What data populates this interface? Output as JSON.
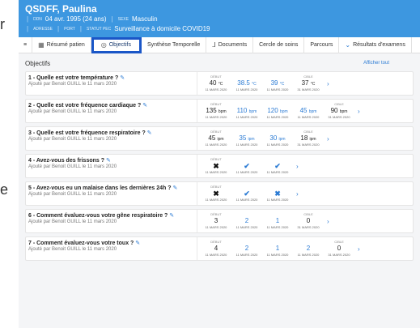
{
  "stray": [
    "r",
    "e"
  ],
  "patient": {
    "name": "QSDFF, Paulina",
    "ddn_label": "DDN",
    "ddn": "04 avr. 1995 (24 ans)",
    "sexe_label": "SEXE",
    "sexe": "Masculin",
    "adresse_label": "ADRESSE",
    "port_label": "PORT",
    "statut_label": "STATUT PEC",
    "statut": "Surveillance à domicile COVID19"
  },
  "nav": {
    "menu_icon": "hamburger-icon",
    "tabs": [
      {
        "label": "Résumé patien",
        "icon": "grid-icon"
      },
      {
        "label": "Objectifs",
        "icon": "target-icon"
      },
      {
        "label": "Synthèse Temporelle",
        "icon": ""
      },
      {
        "label": "Documents",
        "icon": "pin-icon"
      },
      {
        "label": "Cercle de soins",
        "icon": ""
      },
      {
        "label": "Parcours",
        "icon": ""
      },
      {
        "label": "Résultats d'examens",
        "icon": "chart-icon"
      }
    ]
  },
  "section": {
    "title": "Objectifs",
    "show_all": "Afficher tout"
  },
  "rows": [
    {
      "question": "1 - Quelle est votre température ?",
      "meta": "Ajouté par Benoit GUILL le 11 mars 2020",
      "cells": [
        {
          "label": "DÉBUT",
          "value": "40",
          "unit": "°C",
          "date": "11 MARS 2020",
          "kind": "text",
          "color": "dark"
        },
        {
          "label": "",
          "value": "38.5",
          "unit": "°C",
          "date": "11 MARS 2020",
          "kind": "text",
          "color": "blue"
        },
        {
          "label": "",
          "value": "39",
          "unit": "°C",
          "date": "11 MARS 2020",
          "kind": "text",
          "color": "blue"
        },
        {
          "label": "CIBLE",
          "value": "37",
          "unit": "°C",
          "date": "31 MARS 2020",
          "kind": "text",
          "color": "dark"
        }
      ]
    },
    {
      "question": "2 - Quelle est votre fréquence cardiaque ?",
      "meta": "Ajouté par Benoit GUILL le 11 mars 2020",
      "cells": [
        {
          "label": "DÉBUT",
          "value": "135",
          "unit": "bpm",
          "date": "11 MARS 2020",
          "kind": "text",
          "color": "dark"
        },
        {
          "label": "",
          "value": "110",
          "unit": "bpm",
          "date": "11 MARS 2020",
          "kind": "text",
          "color": "blue"
        },
        {
          "label": "",
          "value": "120",
          "unit": "bpm",
          "date": "11 MARS 2020",
          "kind": "text",
          "color": "blue"
        },
        {
          "label": "",
          "value": "45",
          "unit": "bpm",
          "date": "11 MARS 2020",
          "kind": "text",
          "color": "blue"
        },
        {
          "label": "CIBLE",
          "value": "90",
          "unit": "bpm",
          "date": "31 MARS 2020",
          "kind": "text",
          "color": "dark"
        }
      ]
    },
    {
      "question": "3 - Quelle est votre fréquence respiratoire ?",
      "meta": "Ajouté par Benoit GUILL le 11 mars 2020",
      "cells": [
        {
          "label": "DÉBUT",
          "value": "45",
          "unit": "ipm",
          "date": "11 MARS 2020",
          "kind": "text",
          "color": "dark"
        },
        {
          "label": "",
          "value": "35",
          "unit": "ipm",
          "date": "11 MARS 2020",
          "kind": "text",
          "color": "blue"
        },
        {
          "label": "",
          "value": "30",
          "unit": "ipm",
          "date": "11 MARS 2020",
          "kind": "text",
          "color": "blue"
        },
        {
          "label": "CIBLE",
          "value": "18",
          "unit": "ipm",
          "date": "31 MARS 2020",
          "kind": "text",
          "color": "dark"
        }
      ]
    },
    {
      "question": "4 - Avez-vous des frissons ?",
      "meta": "Ajouté par Benoit GUILL le 11 mars 2020",
      "cells": [
        {
          "label": "DÉBUT",
          "value": "✖",
          "unit": "",
          "date": "11 MARS 2020",
          "kind": "mark",
          "color": "dark"
        },
        {
          "label": "",
          "value": "✔",
          "unit": "",
          "date": "11 MARS 2020",
          "kind": "mark",
          "color": "blue"
        },
        {
          "label": "",
          "value": "✔",
          "unit": "",
          "date": "11 MARS 2020",
          "kind": "mark",
          "color": "blue"
        }
      ]
    },
    {
      "question": "5 - Avez-vous eu un malaise dans les dernières 24h ?",
      "meta": "Ajouté par Benoit GUILL le 11 mars 2020",
      "cells": [
        {
          "label": "DÉBUT",
          "value": "✖",
          "unit": "",
          "date": "11 MARS 2020",
          "kind": "mark",
          "color": "dark"
        },
        {
          "label": "",
          "value": "✔",
          "unit": "",
          "date": "11 MARS 2020",
          "kind": "mark",
          "color": "blue"
        },
        {
          "label": "",
          "value": "✖",
          "unit": "",
          "date": "11 MARS 2020",
          "kind": "mark",
          "color": "blue"
        }
      ]
    },
    {
      "question": "6 - Comment évaluez-vous votre gêne respiratoire ?",
      "meta": "Ajouté par Benoit GUILL le 11 mars 2020",
      "cells": [
        {
          "label": "DÉBUT",
          "value": "3",
          "unit": "",
          "date": "11 MARS 2020",
          "kind": "text",
          "color": "dark"
        },
        {
          "label": "",
          "value": "2",
          "unit": "",
          "date": "11 MARS 2020",
          "kind": "text",
          "color": "blue"
        },
        {
          "label": "",
          "value": "1",
          "unit": "",
          "date": "11 MARS 2020",
          "kind": "text",
          "color": "blue"
        },
        {
          "label": "CIBLE",
          "value": "0",
          "unit": "",
          "date": "31 MARS 2020",
          "kind": "text",
          "color": "dark"
        }
      ]
    },
    {
      "question": "7 - Comment évaluez-vous votre toux ?",
      "meta": "Ajouté par Benoit GUILL le 11 mars 2020",
      "cells": [
        {
          "label": "DÉBUT",
          "value": "4",
          "unit": "",
          "date": "11 MARS 2020",
          "kind": "text",
          "color": "dark"
        },
        {
          "label": "",
          "value": "2",
          "unit": "",
          "date": "11 MARS 2020",
          "kind": "text",
          "color": "blue"
        },
        {
          "label": "",
          "value": "1",
          "unit": "",
          "date": "11 MARS 2020",
          "kind": "text",
          "color": "blue"
        },
        {
          "label": "",
          "value": "2",
          "unit": "",
          "date": "11 MARS 2020",
          "kind": "text",
          "color": "blue"
        },
        {
          "label": "CIBLE",
          "value": "0",
          "unit": "",
          "date": "31 MARS 2020",
          "kind": "text",
          "color": "dark"
        }
      ]
    }
  ],
  "colors": {
    "header": "#3d97e0",
    "accent": "#2b7bd4",
    "highlight": "#1a56c7"
  }
}
